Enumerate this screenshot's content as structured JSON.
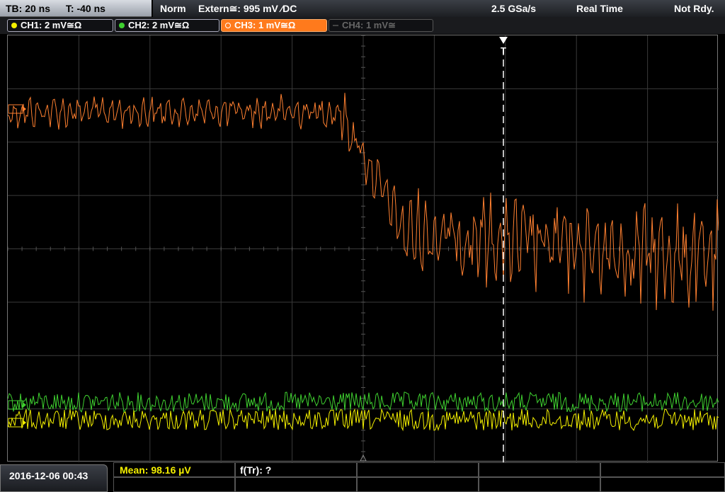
{
  "status": {
    "timebase": "TB: 20 ns",
    "trigger_time": "T: -40 ns",
    "trigger_mode": "Norm",
    "trigger_source": "Extern≅: 995 mV ⁄DC",
    "sample_rate": "2.5 GSa/s",
    "acq_mode": "Real Time",
    "state": "Not Rdy."
  },
  "channels": [
    {
      "label": "CH1: 2 mV≅Ω",
      "color": "#f4f000",
      "active": true
    },
    {
      "label": "CH2: 2 mV≅Ω",
      "color": "#3fd130",
      "active": true
    },
    {
      "label": "CH3: 1 mV≅Ω",
      "color": "#ff7a1c",
      "active": true
    },
    {
      "label": "CH4: 1 mV≅",
      "color": "#666666",
      "active": false
    }
  ],
  "trigger_marker": "T",
  "bottom": {
    "datetime": "2016-12-06 00:43",
    "mean": "Mean: 98.16 µV",
    "ftr": "f(Tr): ?"
  },
  "colors": {
    "ch1": "#f4f000",
    "ch2": "#3fd130",
    "ch3": "#ff8030",
    "grid": "#3a3a3a",
    "trigger_line": "#ffffff"
  }
}
